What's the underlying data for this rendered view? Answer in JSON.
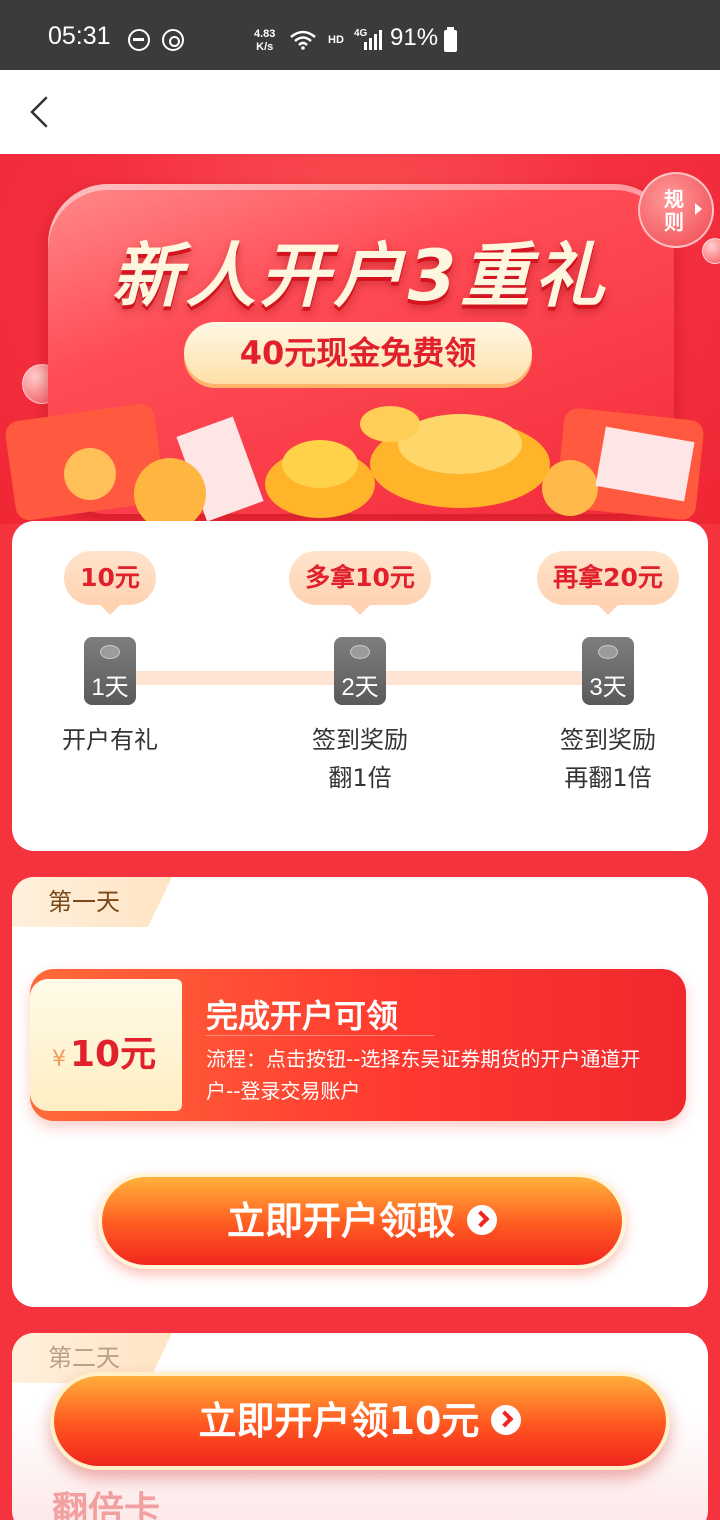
{
  "status_bar": {
    "time": "05:31",
    "speed_value": "4.83",
    "speed_unit": "K/s",
    "hd": "HD",
    "network": "4G",
    "battery": "91%"
  },
  "hero": {
    "title": "新人开户3重礼",
    "subtitle": "40元现金免费领",
    "rules": "规则"
  },
  "progress": {
    "steps": [
      {
        "reward": "10元",
        "day": "1天",
        "desc_line1": "开户有礼",
        "desc_line2": ""
      },
      {
        "reward": "多拿10元",
        "day": "2天",
        "desc_line1": "签到奖励",
        "desc_line2": "翻1倍"
      },
      {
        "reward": "再拿20元",
        "day": "3天",
        "desc_line1": "签到奖励",
        "desc_line2": "再翻1倍"
      }
    ]
  },
  "day_one": {
    "tag": "第一天",
    "coupon": {
      "currency": "¥",
      "amount": "10元",
      "title": "完成开户可领",
      "desc": "流程：点击按钮--选择东吴证券期货的开户通道开户--登录交易账户"
    },
    "cta": "立即开户领取"
  },
  "day_two": {
    "tag": "第二天",
    "partial_text": "翻倍卡"
  },
  "bottom_cta": "立即开户领10元",
  "colors": {
    "brand_red": "#f5333f",
    "accent_orange": "#ff5a22",
    "gold": "#ffe0a8"
  }
}
